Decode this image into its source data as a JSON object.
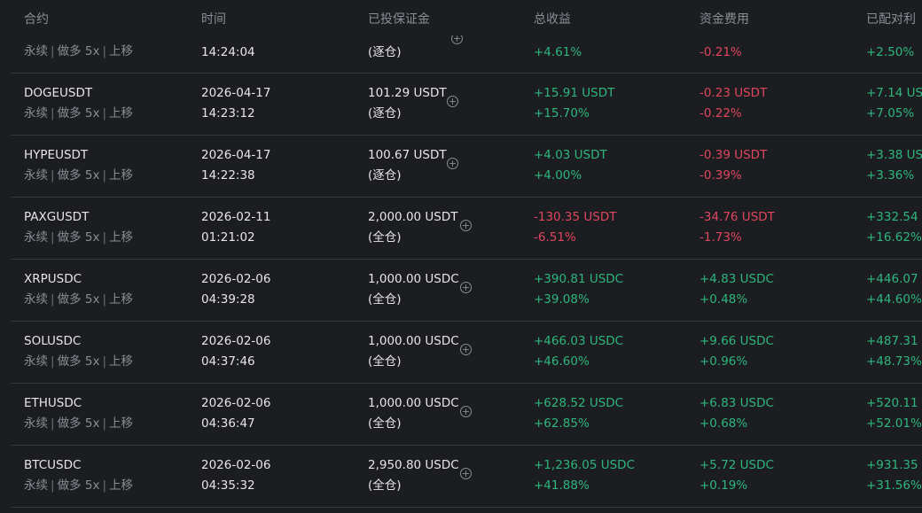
{
  "header": {
    "contract": "合约",
    "time": "时间",
    "margin": "已投保证金",
    "total_pnl": "总收益",
    "funding": "资金费用",
    "allocated": "已配对利"
  },
  "partial_row": {
    "sub": [
      "永续",
      "做多 5x",
      "上移"
    ],
    "time_clock": "14:24:04",
    "margin_mode": "(逐仓)",
    "pnl_pct": "+4.61%",
    "funding_pct": "-0.21%",
    "alloc_pct": "+2.50%"
  },
  "rows": [
    {
      "symbol": "DOGEUSDT",
      "sub": [
        "永续",
        "做多 5x",
        "上移"
      ],
      "date": "2026-04-17",
      "clock": "14:23:12",
      "margin": "101.29 USDT",
      "mode": "(逐仓)",
      "pnl": "+15.91 USDT",
      "pnl_pct": "+15.70%",
      "pnl_sign": "pos",
      "fund": "-0.23 USDT",
      "fund_pct": "-0.22%",
      "fund_sign": "neg",
      "alloc": "+7.14 US",
      "alloc_pct": "+7.05%"
    },
    {
      "symbol": "HYPEUSDT",
      "sub": [
        "永续",
        "做多 5x",
        "上移"
      ],
      "date": "2026-04-17",
      "clock": "14:22:38",
      "margin": "100.67 USDT",
      "mode": "(逐仓)",
      "pnl": "+4.03 USDT",
      "pnl_pct": "+4.00%",
      "pnl_sign": "pos",
      "fund": "-0.39 USDT",
      "fund_pct": "-0.39%",
      "fund_sign": "neg",
      "alloc": "+3.38 US",
      "alloc_pct": "+3.36%"
    },
    {
      "symbol": "PAXGUSDT",
      "sub": [
        "永续",
        "做多 5x",
        "上移"
      ],
      "date": "2026-02-11",
      "clock": "01:21:02",
      "margin": "2,000.00 USDT",
      "mode": "(全仓)",
      "pnl": "-130.35 USDT",
      "pnl_pct": "-6.51%",
      "pnl_sign": "neg",
      "fund": "-34.76 USDT",
      "fund_pct": "-1.73%",
      "fund_sign": "neg",
      "alloc": "+332.54",
      "alloc_pct": "+16.62%"
    },
    {
      "symbol": "XRPUSDC",
      "sub": [
        "永续",
        "做多 5x",
        "上移"
      ],
      "date": "2026-02-06",
      "clock": "04:39:28",
      "margin": "1,000.00 USDC",
      "mode": "(全仓)",
      "pnl": "+390.81 USDC",
      "pnl_pct": "+39.08%",
      "pnl_sign": "pos",
      "fund": "+4.83 USDC",
      "fund_pct": "+0.48%",
      "fund_sign": "pos",
      "alloc": "+446.07",
      "alloc_pct": "+44.60%"
    },
    {
      "symbol": "SOLUSDC",
      "sub": [
        "永续",
        "做多 5x",
        "上移"
      ],
      "date": "2026-02-06",
      "clock": "04:37:46",
      "margin": "1,000.00 USDC",
      "mode": "(全仓)",
      "pnl": "+466.03 USDC",
      "pnl_pct": "+46.60%",
      "pnl_sign": "pos",
      "fund": "+9.66 USDC",
      "fund_pct": "+0.96%",
      "fund_sign": "pos",
      "alloc": "+487.31",
      "alloc_pct": "+48.73%"
    },
    {
      "symbol": "ETHUSDC",
      "sub": [
        "永续",
        "做多 5x",
        "上移"
      ],
      "date": "2026-02-06",
      "clock": "04:36:47",
      "margin": "1,000.00 USDC",
      "mode": "(全仓)",
      "pnl": "+628.52 USDC",
      "pnl_pct": "+62.85%",
      "pnl_sign": "pos",
      "fund": "+6.83 USDC",
      "fund_pct": "+0.68%",
      "fund_sign": "pos",
      "alloc": "+520.11",
      "alloc_pct": "+52.01%"
    },
    {
      "symbol": "BTCUSDC",
      "sub": [
        "永续",
        "做多 5x",
        "上移"
      ],
      "date": "2026-02-06",
      "clock": "04:35:32",
      "margin": "2,950.80 USDC",
      "mode": "(全仓)",
      "pnl": "+1,236.05 USDC",
      "pnl_pct": "+41.88%",
      "pnl_sign": "pos",
      "fund": "+5.72 USDC",
      "fund_pct": "+0.19%",
      "fund_sign": "pos",
      "alloc": "+931.35",
      "alloc_pct": "+31.56%"
    }
  ],
  "icons": {
    "add_margin": "plus-circle-icon"
  },
  "colors": {
    "positive": "#2eb67d",
    "negative": "#e0465e",
    "muted": "#8a8d94",
    "background": "#1c1d21"
  }
}
